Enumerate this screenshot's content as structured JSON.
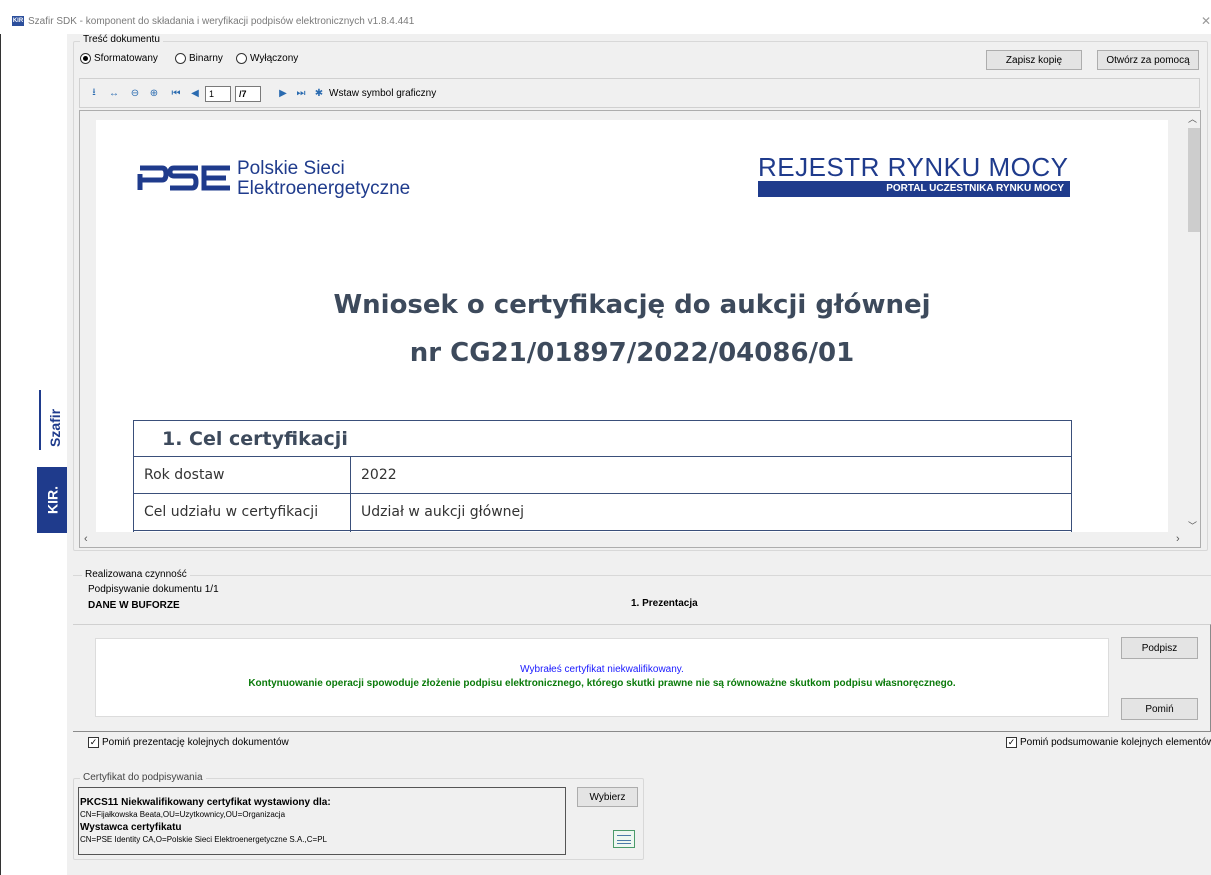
{
  "window": {
    "title": "Szafir SDK - komponent do składania i weryfikacji podpisów elektronicznych v1.8.4.441",
    "icon_label": "KIR",
    "close_glyph": "✕"
  },
  "brand": {
    "vertical_top": "Szafir",
    "vertical_bottom": "KIR."
  },
  "content_group": {
    "legend": "Treść dokumentu",
    "radios": [
      {
        "label": "Sformatowany",
        "selected": true
      },
      {
        "label": "Binarny",
        "selected": false
      },
      {
        "label": "Wyłączony",
        "selected": false
      }
    ],
    "save_copy_label": "Zapisz kopię",
    "open_with_label": "Otwórz za pomocą"
  },
  "toolbar": {
    "current_page": "1",
    "total_pages": "/7",
    "insert_symbol_label": "Wstaw symbol graficzny"
  },
  "document": {
    "pse_logo_mark": "PSE",
    "pse_name_line1": "Polskie Sieci",
    "pse_name_line2": "Elektroenergetyczne",
    "register_title": "REJESTR RYNKU MOCY",
    "register_subtitle": "PORTAL UCZESTNIKA RYNKU MOCY",
    "heading_line1": "Wniosek o certyfikację do aukcji głównej",
    "heading_line2": "nr CG21/01897/2022/04086/01",
    "section_title": "1. Cel certyfikacji",
    "rows": [
      {
        "label": "Rok dostaw",
        "value": "2022"
      },
      {
        "label": "Cel udziału w certyfikacji",
        "value": "Udział w aukcji głównej"
      }
    ]
  },
  "action": {
    "legend": "Realizowana czynność",
    "subtitle": "Podpisywanie dokumentu 1/1",
    "buffer_label": "DANE W BUFORZE",
    "step_label": "1. Prezentacja",
    "message_blue": "Wybrałeś certyfikat niekwalifikowany.",
    "message_green": "Kontynuowanie operacji spowoduje złożenie podpisu elektronicznego, którego skutki prawne nie są równoważne skutkom podpisu własnoręcznego.",
    "sign_label": "Podpisz",
    "skip_label": "Pomiń",
    "skip_next_docs_label": "Pomiń prezentację kolejnych dokumentów",
    "skip_summary_label": "Pomiń podsumowanie kolejnych elementów"
  },
  "certificate": {
    "legend": "Certyfikat do podpisywania",
    "type_label": "PKCS11 Niekwalifikowany certyfikat wystawiony dla:",
    "subject": "CN=Fijałkowska Beata,OU=Uzytkownicy,OU=Organizacja",
    "issuer_label": "Wystawca certyfikatu",
    "issuer": "CN=PSE Identity CA,O=Polskie Sieci Elektroenergetyczne S.A.,C=PL",
    "choose_label": "Wybierz"
  },
  "colors": {
    "kir_blue": "#1f3b8c",
    "heading": "#3d4a5c",
    "message_blue": "#1a1aff",
    "message_green": "#0a7a0a"
  }
}
